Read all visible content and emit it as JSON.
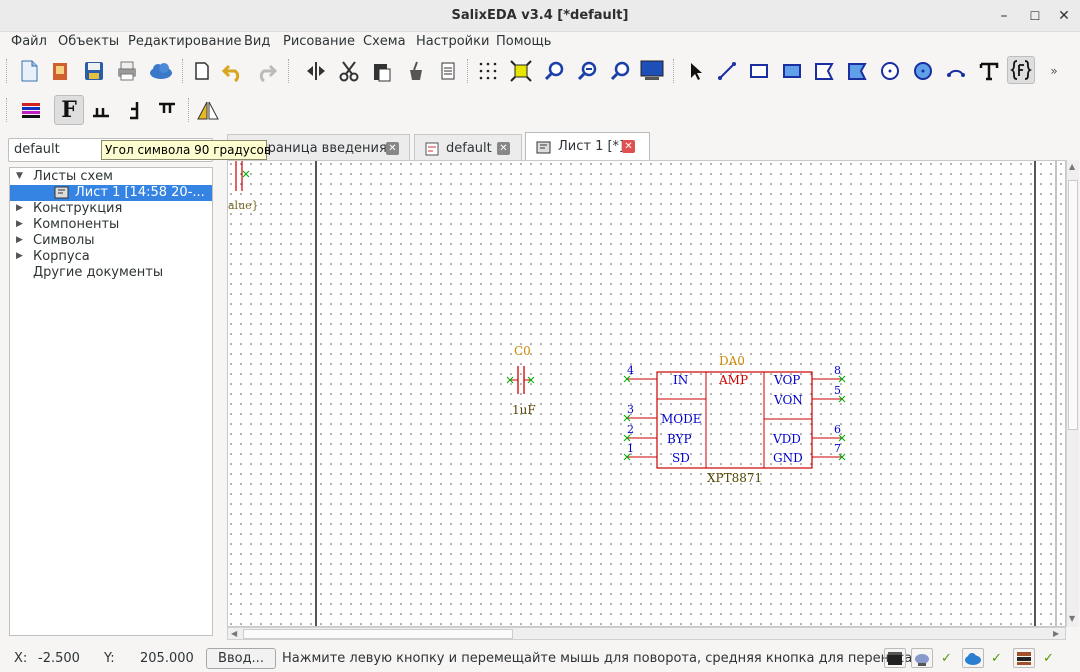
{
  "window": {
    "title": "SalixEDA v3.4 [*default]",
    "controls": [
      "–",
      "☐",
      "✕"
    ]
  },
  "menu": [
    "Файл",
    "Объекты",
    "Редактирование",
    "Вид",
    "Рисование",
    "Схема",
    "Настройки",
    "Помощь"
  ],
  "project_combo": {
    "value": "default"
  },
  "tooltip": "Угол символа 90 градусов",
  "tree": {
    "items": [
      {
        "label": "Листы схем",
        "expanded": true
      },
      {
        "label": "Лист 1 [14:58 20-...",
        "selected": true
      },
      {
        "label": "Конструкция"
      },
      {
        "label": "Компоненты"
      },
      {
        "label": "Символы"
      },
      {
        "label": "Корпуса"
      },
      {
        "label": "Другие документы"
      }
    ]
  },
  "tabs": [
    {
      "label": "траница введения"
    },
    {
      "label": "default"
    },
    {
      "label": "Лист 1 [*]",
      "active": true
    }
  ],
  "schematic": {
    "partial_label": "alue}",
    "capacitor": {
      "ref": "C0",
      "value": "1uF"
    },
    "chip": {
      "ref": "DA0",
      "type": "AMP",
      "name": "XPT8871",
      "left_pins": [
        {
          "num": "4",
          "name": "IN"
        },
        {
          "num": "3",
          "name": "MODE"
        },
        {
          "num": "2",
          "name": "BYP"
        },
        {
          "num": "1",
          "name": "SD"
        }
      ],
      "right_pins": [
        {
          "num": "8",
          "name": "VOP"
        },
        {
          "num": "5",
          "name": "VON"
        },
        {
          "num": "6",
          "name": "VDD"
        },
        {
          "num": "7",
          "name": "GND"
        }
      ]
    }
  },
  "status": {
    "x_label": "X:",
    "x_value": "-2.500",
    "y_label": "Y:",
    "y_value": "205.000",
    "input_button": "Ввод...",
    "hint": "Нажмите левую кнопку и перемещайте мышь для поворота, средняя кнопка для переноса",
    "checks": [
      "✓",
      "✓",
      "✓",
      "✓"
    ]
  },
  "colors": {
    "accent": "#3584e4",
    "sheet_text": "#0000cc",
    "ref_text": "#cc8800",
    "wire": "#cc0000",
    "pin_end": "#00aa00"
  }
}
